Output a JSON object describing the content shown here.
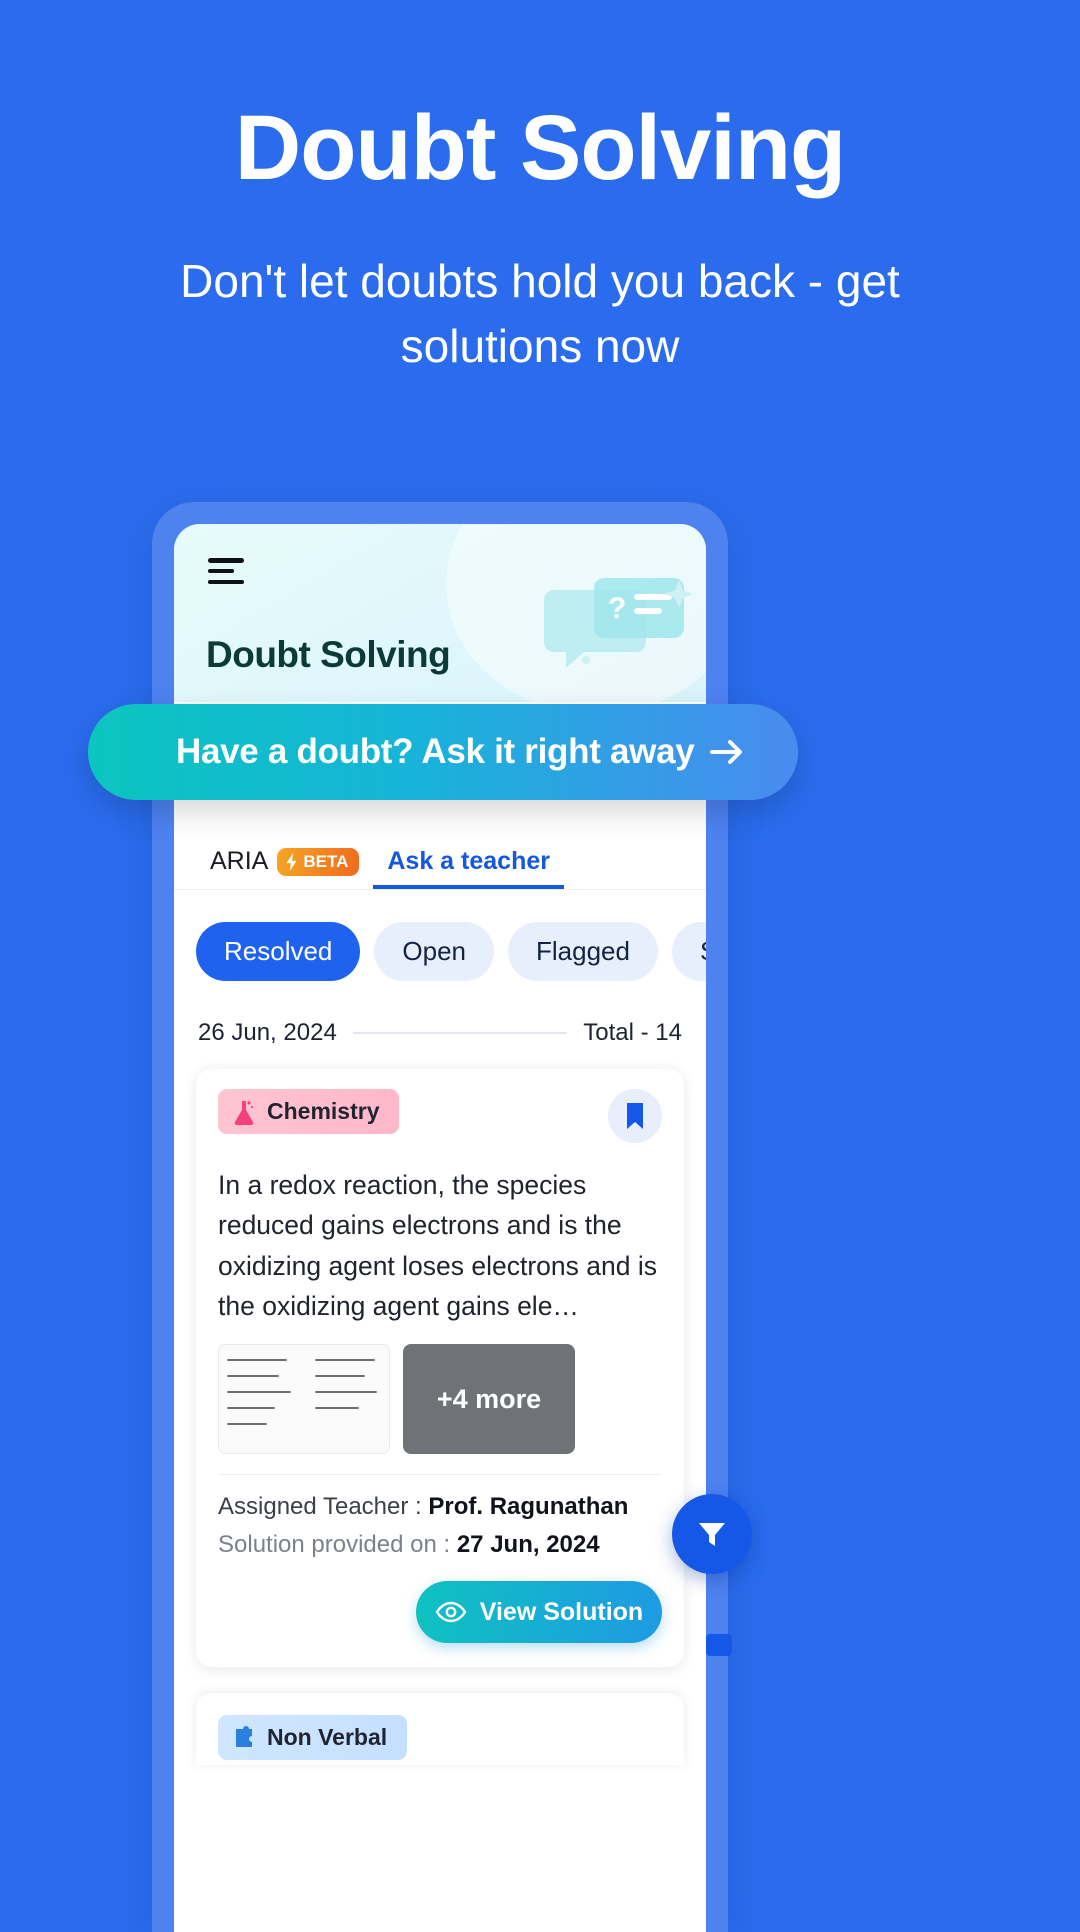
{
  "promo": {
    "title": "Doubt Solving",
    "subtitle": "Don't let doubts hold you back - get solutions now"
  },
  "app": {
    "menu_icon": "hamburger-icon",
    "header_title": "Doubt Solving",
    "header_art_icon": "question-chat-bubble-icon",
    "sparkle_icon": "sparkle-icon"
  },
  "cta": {
    "label": "Have a doubt? Ask it right away",
    "arrow_icon": "arrow-right-icon"
  },
  "tabs": [
    {
      "label": "ARIA",
      "badge": "BETA",
      "badge_icon": "lightning-bolt-icon",
      "active": false
    },
    {
      "label": "Ask a teacher",
      "badge": "",
      "active": true
    }
  ],
  "filters": [
    {
      "label": "Resolved",
      "selected": true
    },
    {
      "label": "Open",
      "selected": false
    },
    {
      "label": "Flagged",
      "selected": false
    },
    {
      "label": "Saved",
      "selected": false
    }
  ],
  "list_header": {
    "date": "26 Jun, 2024",
    "total": "Total - 14"
  },
  "cards": [
    {
      "subject": "Chemistry",
      "subject_icon": "flask-icon",
      "bookmark_icon": "bookmark-icon",
      "question": "In a redox reaction, the species reduced gains electrons and is the oxidizing agent loses electrons and is the oxidizing agent gains ele…",
      "more_label": "+4 more",
      "assigned_label": "Assigned Teacher : ",
      "assigned_value": "Prof. Ragunathan",
      "solution_label": "Solution provided on : ",
      "solution_value": "27 Jun, 2024",
      "action_label": "View Solution",
      "action_icon": "eye-icon"
    },
    {
      "subject": "Non Verbal",
      "subject_icon": "puzzle-icon"
    }
  ],
  "fab": {
    "icon": "filter-funnel-icon"
  },
  "colors": {
    "brand_blue": "#2a6ced",
    "accent_blue": "#1558dd",
    "teal": "#0fc2c0",
    "chip_bg": "#e7eefc",
    "chemistry_pink": "#ffbdcd",
    "beta_orange": "#f06a20"
  }
}
